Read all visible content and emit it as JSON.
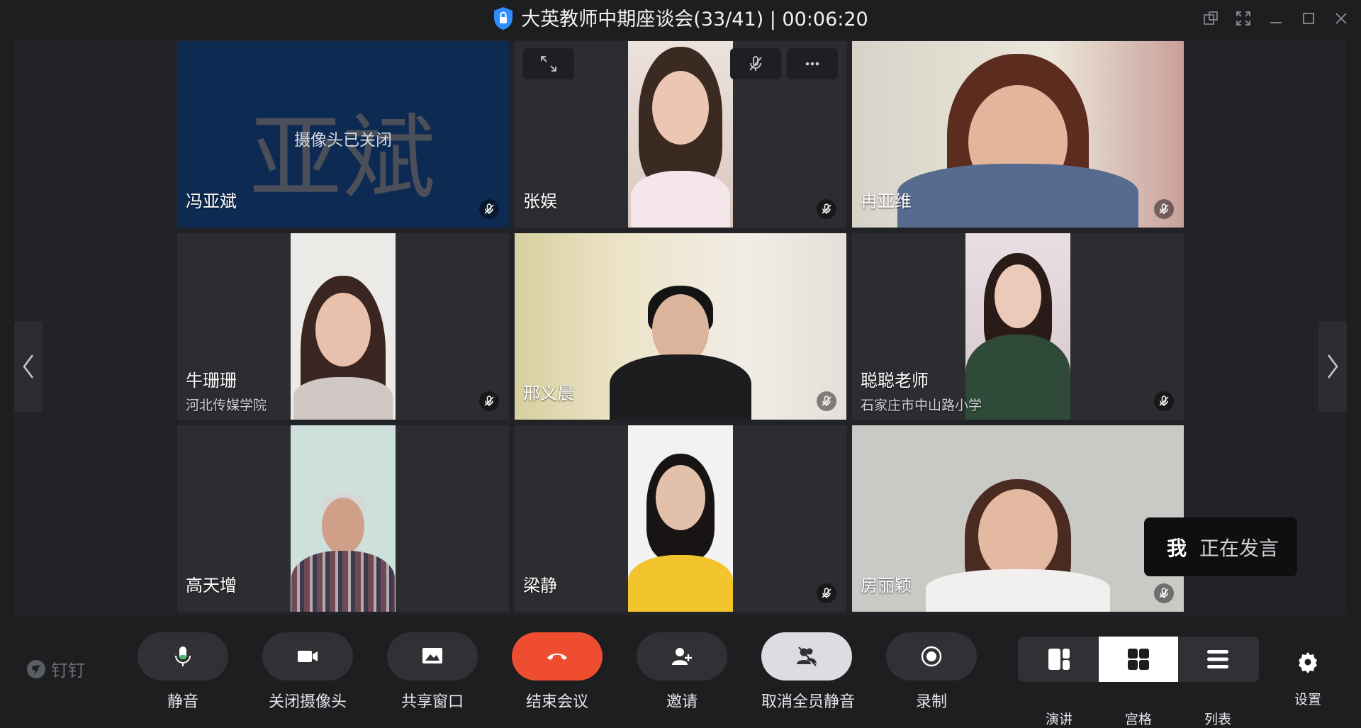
{
  "window": {
    "title": "大英教师中期座谈会(33/41) | 00:06:20"
  },
  "participants": [
    {
      "name": "冯亚斌",
      "camera_off_label": "摄像头已关闭",
      "avatar_text": "亚斌",
      "muted": true
    },
    {
      "name": "张娱",
      "muted": true
    },
    {
      "name": "冉亚维",
      "muted": true
    },
    {
      "name": "牛珊珊",
      "org": "河北传媒学院",
      "muted": true
    },
    {
      "name": "邢义晨",
      "muted": true
    },
    {
      "name": "聪聪老师",
      "org": "石家庄市中山路小学",
      "muted": true
    },
    {
      "name": "高天增",
      "muted": false
    },
    {
      "name": "梁静",
      "muted": true
    },
    {
      "name": "房丽颖",
      "muted": true
    }
  ],
  "speaking_indicator": {
    "me": "我",
    "status": "正在发言"
  },
  "toolbar": {
    "brand": "钉钉",
    "mute": "静音",
    "camera_off": "关闭摄像头",
    "share_window": "共享窗口",
    "end_meeting": "结束会议",
    "invite": "邀请",
    "unmute_all": "取消全员静音",
    "record": "录制",
    "layouts": [
      "演讲",
      "宫格",
      "列表"
    ],
    "active_layout": "宫格",
    "settings": "设置"
  },
  "colors": {
    "end_button": "#ef4d2f",
    "camera_off_tile": "#0d2a52",
    "background": "#1d1e20"
  },
  "icons": [
    "shield-lock-icon",
    "pin-icon",
    "expand-icon",
    "minimize-icon",
    "maximize-icon",
    "close-icon",
    "mic-muted-icon",
    "more-icon",
    "microphone-icon",
    "camera-icon",
    "share-icon",
    "phone-hangup-icon",
    "add-user-icon",
    "mute-all-icon",
    "record-icon",
    "speaker-layout-icon",
    "grid-layout-icon",
    "list-layout-icon",
    "gear-icon",
    "dingtalk-icon"
  ]
}
